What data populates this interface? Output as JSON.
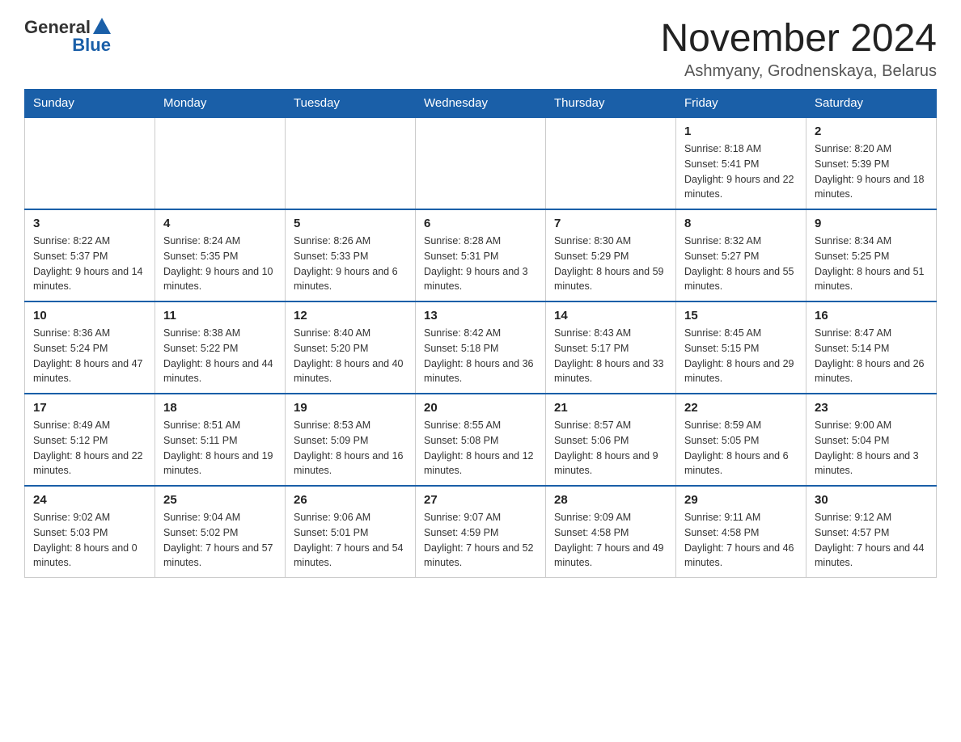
{
  "header": {
    "logo": {
      "general": "General",
      "blue": "Blue"
    },
    "title": "November 2024",
    "subtitle": "Ashmyany, Grodnenskaya, Belarus"
  },
  "calendar": {
    "days_of_week": [
      "Sunday",
      "Monday",
      "Tuesday",
      "Wednesday",
      "Thursday",
      "Friday",
      "Saturday"
    ],
    "weeks": [
      {
        "days": [
          {
            "empty": true
          },
          {
            "empty": true
          },
          {
            "empty": true
          },
          {
            "empty": true
          },
          {
            "empty": true
          },
          {
            "date": "1",
            "sunrise": "Sunrise: 8:18 AM",
            "sunset": "Sunset: 5:41 PM",
            "daylight": "Daylight: 9 hours and 22 minutes."
          },
          {
            "date": "2",
            "sunrise": "Sunrise: 8:20 AM",
            "sunset": "Sunset: 5:39 PM",
            "daylight": "Daylight: 9 hours and 18 minutes."
          }
        ]
      },
      {
        "days": [
          {
            "date": "3",
            "sunrise": "Sunrise: 8:22 AM",
            "sunset": "Sunset: 5:37 PM",
            "daylight": "Daylight: 9 hours and 14 minutes."
          },
          {
            "date": "4",
            "sunrise": "Sunrise: 8:24 AM",
            "sunset": "Sunset: 5:35 PM",
            "daylight": "Daylight: 9 hours and 10 minutes."
          },
          {
            "date": "5",
            "sunrise": "Sunrise: 8:26 AM",
            "sunset": "Sunset: 5:33 PM",
            "daylight": "Daylight: 9 hours and 6 minutes."
          },
          {
            "date": "6",
            "sunrise": "Sunrise: 8:28 AM",
            "sunset": "Sunset: 5:31 PM",
            "daylight": "Daylight: 9 hours and 3 minutes."
          },
          {
            "date": "7",
            "sunrise": "Sunrise: 8:30 AM",
            "sunset": "Sunset: 5:29 PM",
            "daylight": "Daylight: 8 hours and 59 minutes."
          },
          {
            "date": "8",
            "sunrise": "Sunrise: 8:32 AM",
            "sunset": "Sunset: 5:27 PM",
            "daylight": "Daylight: 8 hours and 55 minutes."
          },
          {
            "date": "9",
            "sunrise": "Sunrise: 8:34 AM",
            "sunset": "Sunset: 5:25 PM",
            "daylight": "Daylight: 8 hours and 51 minutes."
          }
        ]
      },
      {
        "days": [
          {
            "date": "10",
            "sunrise": "Sunrise: 8:36 AM",
            "sunset": "Sunset: 5:24 PM",
            "daylight": "Daylight: 8 hours and 47 minutes."
          },
          {
            "date": "11",
            "sunrise": "Sunrise: 8:38 AM",
            "sunset": "Sunset: 5:22 PM",
            "daylight": "Daylight: 8 hours and 44 minutes."
          },
          {
            "date": "12",
            "sunrise": "Sunrise: 8:40 AM",
            "sunset": "Sunset: 5:20 PM",
            "daylight": "Daylight: 8 hours and 40 minutes."
          },
          {
            "date": "13",
            "sunrise": "Sunrise: 8:42 AM",
            "sunset": "Sunset: 5:18 PM",
            "daylight": "Daylight: 8 hours and 36 minutes."
          },
          {
            "date": "14",
            "sunrise": "Sunrise: 8:43 AM",
            "sunset": "Sunset: 5:17 PM",
            "daylight": "Daylight: 8 hours and 33 minutes."
          },
          {
            "date": "15",
            "sunrise": "Sunrise: 8:45 AM",
            "sunset": "Sunset: 5:15 PM",
            "daylight": "Daylight: 8 hours and 29 minutes."
          },
          {
            "date": "16",
            "sunrise": "Sunrise: 8:47 AM",
            "sunset": "Sunset: 5:14 PM",
            "daylight": "Daylight: 8 hours and 26 minutes."
          }
        ]
      },
      {
        "days": [
          {
            "date": "17",
            "sunrise": "Sunrise: 8:49 AM",
            "sunset": "Sunset: 5:12 PM",
            "daylight": "Daylight: 8 hours and 22 minutes."
          },
          {
            "date": "18",
            "sunrise": "Sunrise: 8:51 AM",
            "sunset": "Sunset: 5:11 PM",
            "daylight": "Daylight: 8 hours and 19 minutes."
          },
          {
            "date": "19",
            "sunrise": "Sunrise: 8:53 AM",
            "sunset": "Sunset: 5:09 PM",
            "daylight": "Daylight: 8 hours and 16 minutes."
          },
          {
            "date": "20",
            "sunrise": "Sunrise: 8:55 AM",
            "sunset": "Sunset: 5:08 PM",
            "daylight": "Daylight: 8 hours and 12 minutes."
          },
          {
            "date": "21",
            "sunrise": "Sunrise: 8:57 AM",
            "sunset": "Sunset: 5:06 PM",
            "daylight": "Daylight: 8 hours and 9 minutes."
          },
          {
            "date": "22",
            "sunrise": "Sunrise: 8:59 AM",
            "sunset": "Sunset: 5:05 PM",
            "daylight": "Daylight: 8 hours and 6 minutes."
          },
          {
            "date": "23",
            "sunrise": "Sunrise: 9:00 AM",
            "sunset": "Sunset: 5:04 PM",
            "daylight": "Daylight: 8 hours and 3 minutes."
          }
        ]
      },
      {
        "days": [
          {
            "date": "24",
            "sunrise": "Sunrise: 9:02 AM",
            "sunset": "Sunset: 5:03 PM",
            "daylight": "Daylight: 8 hours and 0 minutes."
          },
          {
            "date": "25",
            "sunrise": "Sunrise: 9:04 AM",
            "sunset": "Sunset: 5:02 PM",
            "daylight": "Daylight: 7 hours and 57 minutes."
          },
          {
            "date": "26",
            "sunrise": "Sunrise: 9:06 AM",
            "sunset": "Sunset: 5:01 PM",
            "daylight": "Daylight: 7 hours and 54 minutes."
          },
          {
            "date": "27",
            "sunrise": "Sunrise: 9:07 AM",
            "sunset": "Sunset: 4:59 PM",
            "daylight": "Daylight: 7 hours and 52 minutes."
          },
          {
            "date": "28",
            "sunrise": "Sunrise: 9:09 AM",
            "sunset": "Sunset: 4:58 PM",
            "daylight": "Daylight: 7 hours and 49 minutes."
          },
          {
            "date": "29",
            "sunrise": "Sunrise: 9:11 AM",
            "sunset": "Sunset: 4:58 PM",
            "daylight": "Daylight: 7 hours and 46 minutes."
          },
          {
            "date": "30",
            "sunrise": "Sunrise: 9:12 AM",
            "sunset": "Sunset: 4:57 PM",
            "daylight": "Daylight: 7 hours and 44 minutes."
          }
        ]
      }
    ]
  }
}
